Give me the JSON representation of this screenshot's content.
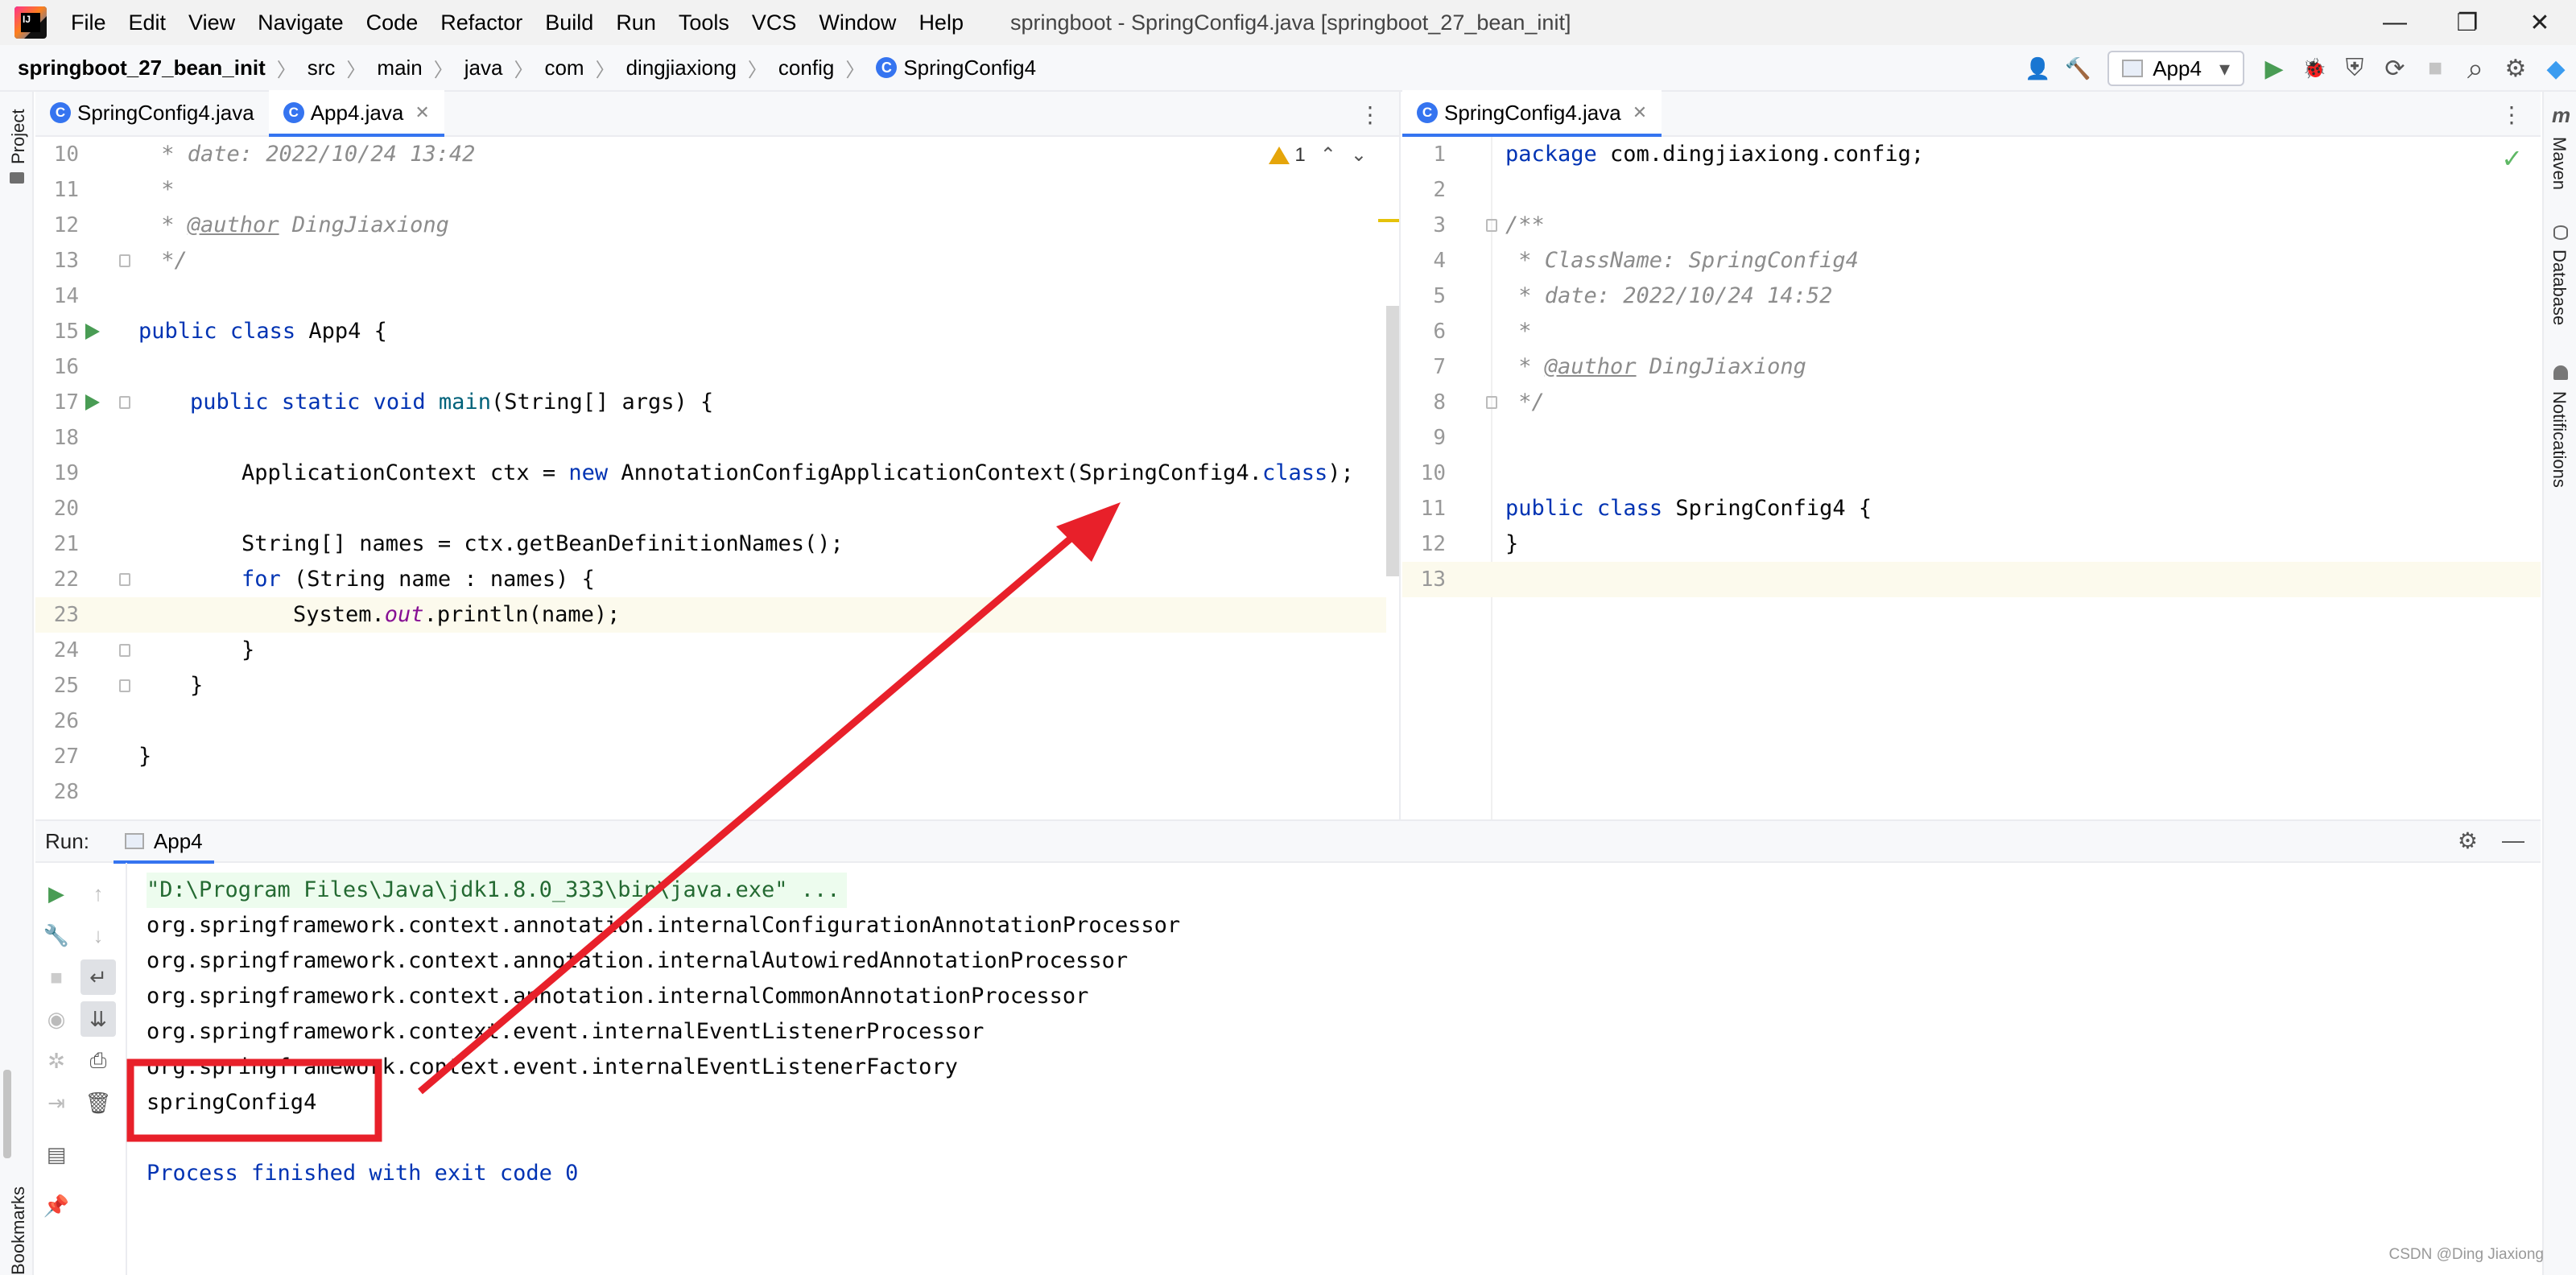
{
  "menu": {
    "items": [
      "File",
      "Edit",
      "View",
      "Navigate",
      "Code",
      "Refactor",
      "Build",
      "Run",
      "Tools",
      "VCS",
      "Window",
      "Help"
    ],
    "window_title": "springboot - SpringConfig4.java [springboot_27_bean_init]"
  },
  "window_controls": {
    "minimize": "—",
    "restore": "❐",
    "close": "✕"
  },
  "breadcrumb": {
    "project": "springboot_27_bean_init",
    "parts": [
      "src",
      "main",
      "java",
      "com",
      "dingjiaxiong",
      "config"
    ],
    "file": "SpringConfig4",
    "file_icon": "C"
  },
  "toolbar": {
    "run_config": "App4",
    "dropdown": "▾",
    "user_icon": "👤",
    "build_icon": "🔨",
    "run_icon": "▶",
    "debug_icon": "🐞",
    "coverage_icon": "⛨",
    "profile_icon": "⟳",
    "stop_icon": "■",
    "search_icon": "⌕",
    "settings_icon": "⚙",
    "logo_icon": "◆"
  },
  "strips": {
    "left_top": "Project",
    "left_bottom": "Bookmarks",
    "right_1": "Maven",
    "right_2": "Database",
    "right_3": "Notifications"
  },
  "editor_left": {
    "tabs": [
      {
        "label": "SpringConfig4.java",
        "active": false
      },
      {
        "label": "App4.java",
        "active": true
      }
    ],
    "warnings": "1",
    "lines": [
      {
        "n": "10",
        "code": " * date: 2022/10/24 13:42"
      },
      {
        "n": "11",
        "code": " *"
      },
      {
        "n": "12",
        "tag": "@author",
        "rest": " DingJiaxiong"
      },
      {
        "n": "13",
        "code": " */"
      },
      {
        "n": "14",
        "code": ""
      },
      {
        "n": "15",
        "kw1": "public",
        "kw2": "class",
        "rest": " App4 {"
      },
      {
        "n": "16",
        "code": ""
      },
      {
        "n": "17",
        "kw1": "public",
        "kw2": "static",
        "kw3": "void",
        "fn": "main",
        "rest": "(String[] args) {"
      },
      {
        "n": "18",
        "code": ""
      },
      {
        "n": "19",
        "pre": "ApplicationContext ctx = ",
        "kw": "new",
        "mid": " AnnotationConfigApplicationContext(SpringConfig4.",
        "kw_b": "class",
        "post": ");"
      },
      {
        "n": "20",
        "code": ""
      },
      {
        "n": "21",
        "code": "String[] names = ctx.getBeanDefinitionNames();"
      },
      {
        "n": "22",
        "kw": "for",
        "rest": " (String name : names) {"
      },
      {
        "n": "23",
        "pre": "System.",
        "fld": "out",
        "post": ".println(name);"
      },
      {
        "n": "24",
        "code": "}"
      },
      {
        "n": "25",
        "code": "}"
      },
      {
        "n": "26",
        "code": ""
      },
      {
        "n": "27",
        "code": "}"
      },
      {
        "n": "28",
        "code": ""
      }
    ]
  },
  "editor_right": {
    "tabs": [
      {
        "label": "SpringConfig4.java",
        "active": true
      }
    ],
    "lines": [
      {
        "n": "1",
        "kw": "package",
        "rest": " com.dingjiaxiong.config;"
      },
      {
        "n": "2",
        "code": ""
      },
      {
        "n": "3",
        "code": "/**"
      },
      {
        "n": "4",
        "code": " * ClassName: SpringConfig4"
      },
      {
        "n": "5",
        "code": " * date: 2022/10/24 14:52"
      },
      {
        "n": "6",
        "code": " *"
      },
      {
        "n": "7",
        "tag": "@author",
        "rest": " DingJiaxiong"
      },
      {
        "n": "8",
        "code": " */"
      },
      {
        "n": "9",
        "code": ""
      },
      {
        "n": "10",
        "code": ""
      },
      {
        "n": "11",
        "kw1": "public",
        "kw2": "class",
        "rest": " SpringConfig4 {"
      },
      {
        "n": "12",
        "code": "}"
      },
      {
        "n": "13",
        "code": ""
      }
    ]
  },
  "run": {
    "label": "Run:",
    "tab": "App4",
    "console": [
      "\"D:\\Program Files\\Java\\jdk1.8.0_333\\bin\\java.exe\" ...",
      "org.springframework.context.annotation.internalConfigurationAnnotationProcessor",
      "org.springframework.context.annotation.internalAutowiredAnnotationProcessor",
      "org.springframework.context.annotation.internalCommonAnnotationProcessor",
      "org.springframework.context.event.internalEventListenerProcessor",
      "org.springframework.context.event.internalEventListenerFactory",
      "springConfig4",
      "",
      "Process finished with exit code 0"
    ]
  },
  "watermark": "CSDN @Ding Jiaxiong",
  "colors": {
    "accent": "#3574f0",
    "annotation": "#e8202a",
    "keyword": "#0033b3",
    "comment": "#8c8c8c"
  }
}
